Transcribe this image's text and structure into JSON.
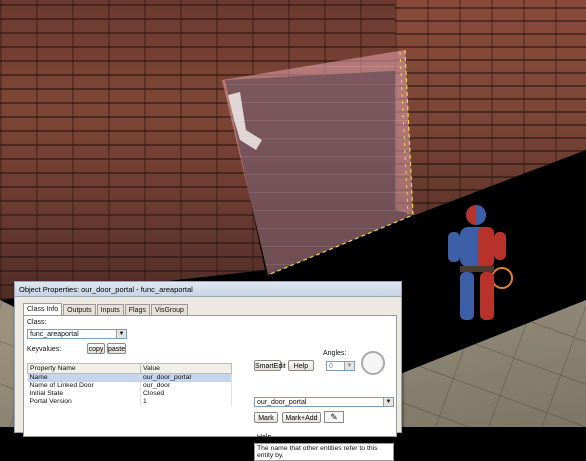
{
  "dialog": {
    "title": "Object Properties: our_door_portal - func_areaportal",
    "tabs": [
      "Class Info",
      "Outputs",
      "Inputs",
      "Flags",
      "VisGroup"
    ],
    "class_label": "Class:",
    "class_value": "func_areaportal",
    "keyvalues_label": "Keyvalues:",
    "copy_label": "copy",
    "paste_label": "paste",
    "smartedit_label": "SmartEdit",
    "help_button_label": "Help",
    "angles_label": "Angles:",
    "angles_value": "0",
    "table": {
      "headers": [
        "Property Name",
        "Value"
      ],
      "rows": [
        {
          "name": "Name",
          "value": "our_door_portal"
        },
        {
          "name": "Name of Linked Door",
          "value": "our_door"
        },
        {
          "name": "Initial State",
          "value": "Closed"
        },
        {
          "name": "Portal Version",
          "value": "1"
        }
      ]
    },
    "value_combo": "our_door_portal",
    "mark_label": "Mark",
    "mark_add_label": "Mark+Add",
    "eyedropper_icon": "eyedropper-icon",
    "help_heading": "Help",
    "help_text": "The name that other entities refer to this entity by."
  },
  "colors": {
    "wall_brick": "#7e4636",
    "portal_pink": "#e6a8b4",
    "portal_edge": "#e8d84a",
    "figure_red": "#b8322c",
    "figure_blue": "#3d5fa8",
    "dialog_bg": "#ece9e2",
    "selected_row": "#c5d5ee"
  }
}
